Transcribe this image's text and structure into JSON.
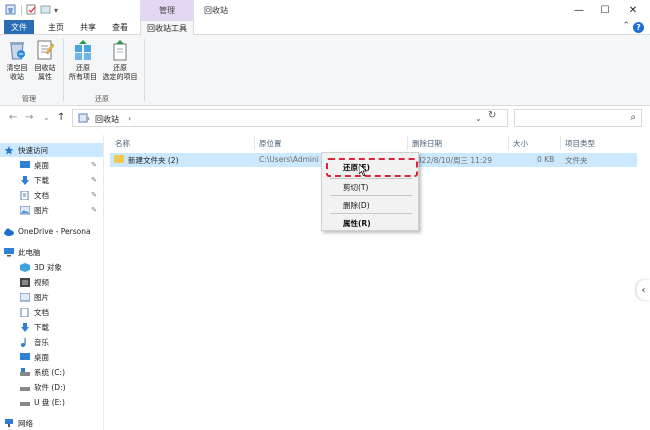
{
  "window": {
    "title": "回收站",
    "context_tab": "管理",
    "controls": {
      "minimize": "—",
      "maximize": "☐",
      "close": "✕"
    }
  },
  "ribbon_tabs": {
    "file": "文件",
    "home": "主页",
    "share": "共享",
    "view": "查看",
    "recycle_tools": "回收站工具"
  },
  "ribbon": {
    "empty_recycle_bin": "清空回\n收站",
    "recycle_bin_properties": "回收站\n属性",
    "restore_all": "还原\n所有项目",
    "restore_selected": "还原\n选定的项目",
    "group_manage": "管理",
    "group_restore": "还原"
  },
  "address_bar": {
    "path": "回收站",
    "separator": "›",
    "dropdown": "⌄",
    "refresh": "↻",
    "search_placeholder": ""
  },
  "nav_pane": {
    "quick_access": "快速访问",
    "quick_items": [
      "桌面",
      "下载",
      "文档",
      "图片"
    ],
    "onedrive": "OneDrive - Persona",
    "this_pc": "此电脑",
    "pc_items": [
      "3D 对象",
      "视频",
      "图片",
      "文档",
      "下载",
      "音乐",
      "桌面",
      "系统 (C:)",
      "软件 (D:)",
      "U 盘 (E:)"
    ],
    "network": "网络"
  },
  "columns": {
    "name": "名称",
    "original_location": "原位置",
    "date_deleted": "删除日期",
    "size": "大小",
    "item_type": "项目类型"
  },
  "files": [
    {
      "name": "新建文件夹 (2)",
      "original_location": "C:\\Users\\Admini",
      "date_deleted": "2022/8/10/周三 11:29",
      "size": "0 KB",
      "item_type": "文件夹"
    }
  ],
  "context_menu": {
    "restore": "还原(E)",
    "cut": "剪切(T)",
    "delete": "删除(D)",
    "properties": "属性(R)"
  },
  "colors": {
    "file_tab": "#2b6cb7",
    "context_tab": "#e3d8f4",
    "selection": "#cce8ff",
    "highlight_dash": "#d9243a"
  }
}
